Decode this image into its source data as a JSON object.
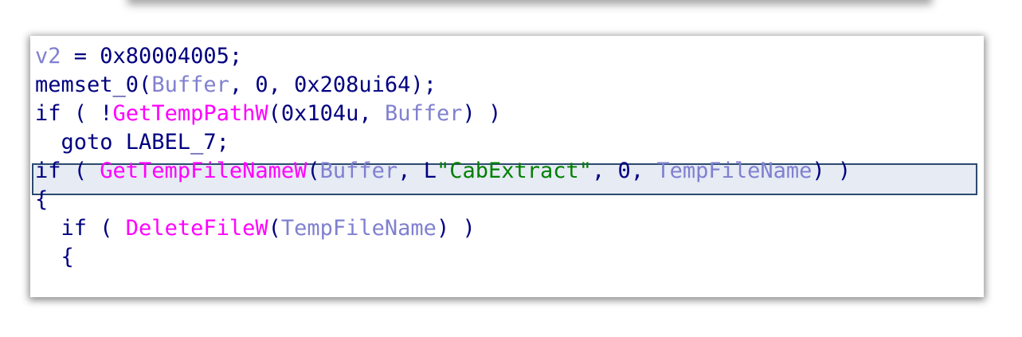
{
  "code_lines": [
    [
      {
        "t": "v2",
        "c": "var"
      },
      {
        "t": " = 0x80004005;",
        "c": "kw"
      }
    ],
    [
      {
        "t": "memset_0(",
        "c": "kw"
      },
      {
        "t": "Buffer",
        "c": "var"
      },
      {
        "t": ", 0, 0x208ui64);",
        "c": "kw"
      }
    ],
    [
      {
        "t": "if ( !",
        "c": "kw"
      },
      {
        "t": "GetTempPathW",
        "c": "fn"
      },
      {
        "t": "(0x104u, ",
        "c": "kw"
      },
      {
        "t": "Buffer",
        "c": "var"
      },
      {
        "t": ") )",
        "c": "kw"
      }
    ],
    [
      {
        "t": "  goto LABEL_7;",
        "c": "kw"
      }
    ],
    [
      {
        "t": "if ( ",
        "c": "kw"
      },
      {
        "t": "GetTempFileNameW",
        "c": "fn"
      },
      {
        "t": "(",
        "c": "kw"
      },
      {
        "t": "Buffer",
        "c": "var"
      },
      {
        "t": ", L",
        "c": "kw"
      },
      {
        "t": "\"CabExtract\"",
        "c": "str"
      },
      {
        "t": ", 0, ",
        "c": "kw"
      },
      {
        "t": "TempFileName",
        "c": "var"
      },
      {
        "t": ") )",
        "c": "kw"
      }
    ],
    [
      {
        "t": "{",
        "c": "kw"
      }
    ],
    [
      {
        "t": "  if ( ",
        "c": "kw"
      },
      {
        "t": "DeleteFileW",
        "c": "fn"
      },
      {
        "t": "(",
        "c": "kw"
      },
      {
        "t": "TempFileName",
        "c": "var"
      },
      {
        "t": ") )",
        "c": "kw"
      }
    ],
    [
      {
        "t": "  {",
        "c": "kw"
      }
    ]
  ],
  "highlighted_line_index": 4,
  "colors": {
    "keyword": "#000080",
    "local_variable": "#8080d0",
    "imported_function": "#ff00ff",
    "string_literal": "#008000",
    "highlight_background": "#e6ebf4",
    "highlight_border": "#2c4a6e"
  }
}
